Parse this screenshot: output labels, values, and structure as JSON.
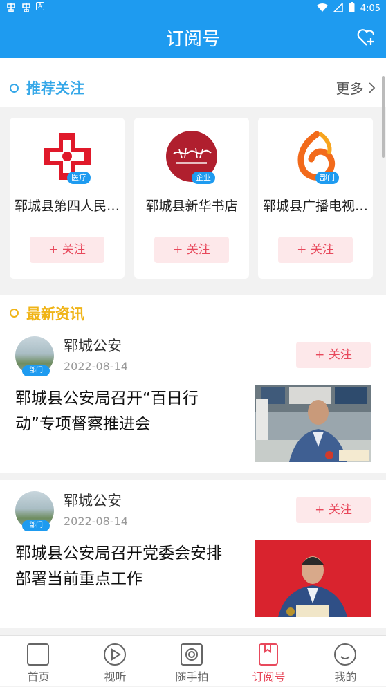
{
  "status": {
    "time": "4:05",
    "left_icons": [
      "notification-icon",
      "notification-icon",
      "app-icon"
    ]
  },
  "header": {
    "title": "订阅号"
  },
  "recommend": {
    "title": "推荐关注",
    "more": "更多",
    "cards": [
      {
        "name": "郓城县第四人民…",
        "badge": "医疗",
        "follow": "+ 关注"
      },
      {
        "name": "郓城县新华书店",
        "badge": "企业",
        "follow": "+ 关注"
      },
      {
        "name": "郓城县广播电视…",
        "badge": "部门",
        "follow": "+ 关注"
      }
    ]
  },
  "latest": {
    "title": "最新资讯",
    "items": [
      {
        "author": "郓城公安",
        "date": "2022-08-14",
        "badge": "部门",
        "follow": "+ 关注",
        "headline": "郓城县公安局召开“百日行动”专项督察推进会"
      },
      {
        "author": "郓城公安",
        "date": "2022-08-14",
        "badge": "部门",
        "follow": "+ 关注",
        "headline": "郓城县公安局召开党委会安排部署当前重点工作"
      }
    ]
  },
  "tabs": [
    {
      "label": "首页",
      "icon": "home-icon"
    },
    {
      "label": "视听",
      "icon": "play-icon"
    },
    {
      "label": "随手拍",
      "icon": "camera-icon"
    },
    {
      "label": "订阅号",
      "icon": "bookmark-icon",
      "active": true
    },
    {
      "label": "我的",
      "icon": "profile-icon"
    }
  ],
  "colors": {
    "primary": "#1e9bf0",
    "active_tab": "#e8495c",
    "recommend_title": "#34a7e8",
    "latest_title": "#f0b417"
  }
}
